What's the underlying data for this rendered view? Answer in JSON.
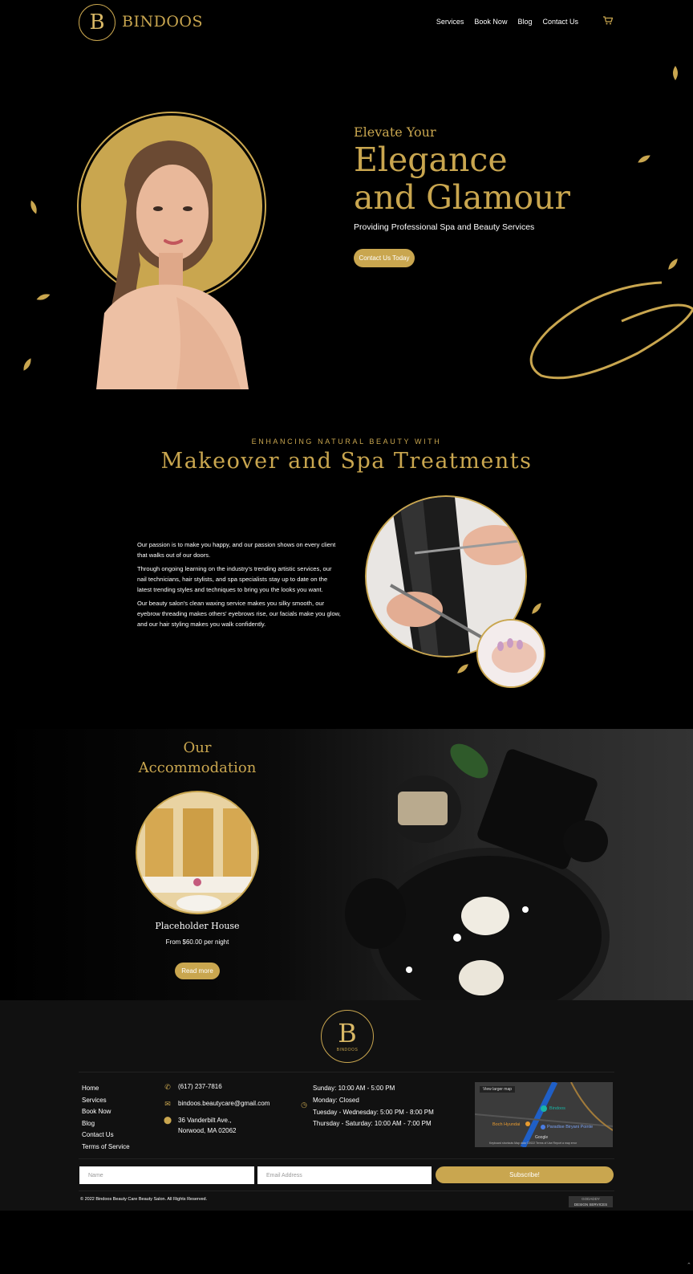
{
  "header": {
    "logo_text": "BINDOOS",
    "nav": [
      "Services",
      "Book Now",
      "Blog",
      "Contact Us"
    ],
    "cart_icon": "cart-icon"
  },
  "hero": {
    "eyebrow": "Elevate Your",
    "title_line1": "Elegance",
    "title_line2": "and Glamour",
    "subtitle": "Providing Professional Spa and Beauty Services",
    "cta": "Contact Us Today"
  },
  "makeover": {
    "eyebrow": "ENHANCING NATURAL BEAUTY WITH",
    "title": "Makeover and Spa Treatments",
    "paragraphs": [
      "Our passion is to make you happy, and our passion shows on every client that walks out of our doors.",
      "Through ongoing learning on the industry's trending artistic services, our nail technicians, hair stylists, and spa specialists stay up to date on the latest trending styles and techniques to bring you the looks you want.",
      "Our beauty salon's clean waxing service makes you silky smooth, our eyebrow threading makes others' eyebrows rise, our facials make you glow, and our hair styling makes you walk confidently."
    ]
  },
  "accommodation": {
    "title_line1": "Our",
    "title_line2": "Accommodation",
    "item_name": "Placeholder House",
    "item_price": "From $60.00 per night",
    "button": "Read more"
  },
  "footer": {
    "logo_text": "BINDOOS",
    "links": [
      "Home",
      "Services",
      "Book Now",
      "Blog",
      "Contact Us",
      "Terms of Service"
    ],
    "phone": "(617) 237-7816",
    "email": "bindoos.beautycare@gmail.com",
    "address_line1": "36 Vanderbilt Ave.,",
    "address_line2": "Norwood, MA 02062",
    "hours": [
      "Sunday: 10:00 AM - 5:00 PM",
      "Monday: Closed",
      "Tuesday - Wednesday: 5:00 PM - 8:00 PM",
      "Thursday - Saturday: 10:00 AM - 7:00 PM"
    ],
    "map": {
      "view_larger": "View larger map",
      "label_bindoos": "Bindoos",
      "label_hyundai": "Boch Hyundai",
      "label_paradise": "Paradise Biryani Pointe",
      "label_google": "Google",
      "label_terms": "Keyboard shortcuts  Map data ©2022  Terms of Use  Report a map error"
    },
    "name_placeholder": "Name",
    "email_placeholder": "Email Address",
    "subscribe": "Subscribe!",
    "copyright": "© 2022 Bindoos Beauty Care Beauty Salon. All Rights Reserved.",
    "badge_line1": "GODADDY",
    "badge_line2": "DESIGN SERVICES"
  },
  "colors": {
    "gold": "#c9a64f",
    "background": "#000000",
    "footer": "#111111"
  }
}
